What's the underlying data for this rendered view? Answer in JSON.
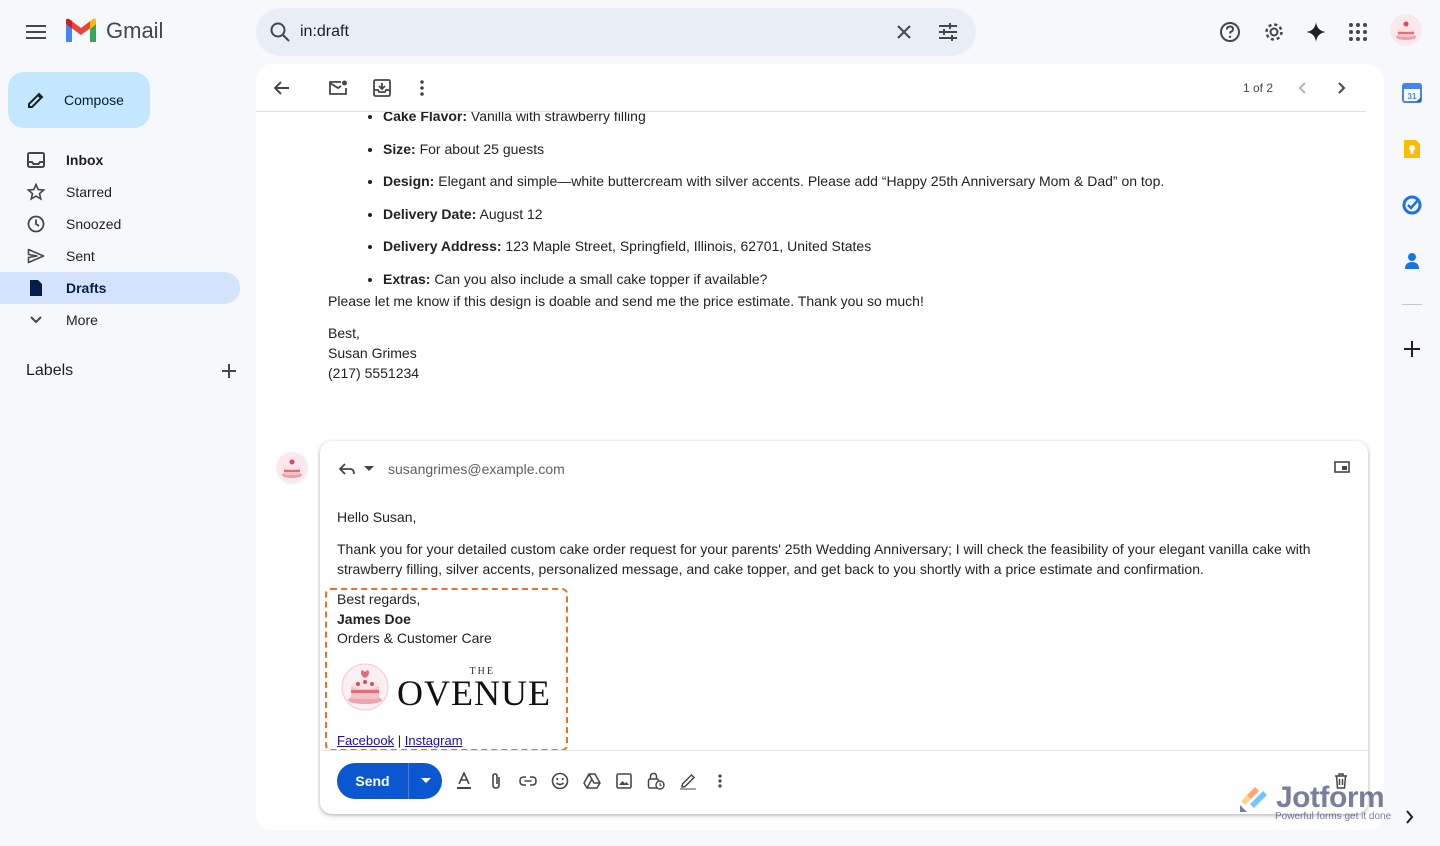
{
  "app": {
    "name": "Gmail"
  },
  "search": {
    "value": "in:draft"
  },
  "compose_label": "Compose",
  "nav": {
    "inbox": "Inbox",
    "starred": "Starred",
    "snoozed": "Snoozed",
    "sent": "Sent",
    "drafts": "Drafts",
    "more": "More"
  },
  "labels_title": "Labels",
  "pager": "1 of 2",
  "email": {
    "items": [
      {
        "key": "Cake Flavor:",
        "value": " Vanilla with strawberry filling"
      },
      {
        "key": "Size:",
        "value": " For about 25 guests"
      },
      {
        "key": "Design:",
        "value": " Elegant and simple—white buttercream with silver accents. Please add “Happy 25th Anniversary Mom & Dad” on top."
      },
      {
        "key": "Delivery Date:",
        "value": " August 12"
      },
      {
        "key": "Delivery Address:",
        "value": " 123 Maple Street, Springfield, Illinois, 62701, United States"
      },
      {
        "key": "Extras:",
        "value": " Can you also include a small cake topper if available?"
      }
    ],
    "closing_line": "Please let me know if this design is doable and send me the price estimate. Thank you so much!",
    "signoff": "Best,",
    "sender_name": "Susan Grimes",
    "sender_phone": "(217) 5551234"
  },
  "reply": {
    "to": "susangrimes@example.com",
    "greeting": "Hello Susan,",
    "body": "Thank you for your detailed custom cake order request for your parents' 25th Wedding Anniversary; I will check the feasibility of your elegant vanilla cake with strawberry filling, silver accents, personalized message, and cake topper, and get back to you shortly with a price estimate and confirmation.",
    "signature": {
      "regards": "Best regards,",
      "name": "James Doe",
      "title": "Orders & Customer Care",
      "brand_small": "THE",
      "brand_main": "OVENUE",
      "link_facebook": "Facebook",
      "link_sep": "|",
      "link_instagram": "Instagram"
    },
    "send_label": "Send"
  },
  "watermark": {
    "name": "Jotform",
    "tagline": "Powerful forms get it done"
  },
  "colors": {
    "accent": "#0b57d0",
    "compose_bg": "#c2e7ff",
    "active_nav": "#d3e3fd",
    "sig_border": "#e8712a"
  }
}
